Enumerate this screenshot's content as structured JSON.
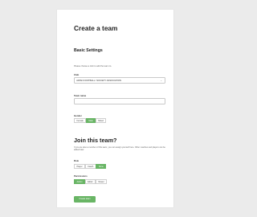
{
  "page": {
    "title": "Create a team",
    "basic_settings_title": "Basic Settings",
    "help_text": "Please choose a club to add the team to."
  },
  "club": {
    "label": "Club",
    "selected": "JAPAN FOOTBALL / SOCIETY ASSOCIATION"
  },
  "team_name": {
    "label": "Team name",
    "value": ""
  },
  "gender": {
    "label": "Gender",
    "options": [
      "Female",
      "Male",
      "Mixed"
    ],
    "selected": "Male"
  },
  "join": {
    "title": "Join this team?",
    "help_text": "If you are also a member of this team, you can assign yourself here. Other coaches and players can be added later.",
    "role": {
      "label": "Role",
      "options": [
        "Player",
        "Coach",
        "None"
      ],
      "selected": "None"
    },
    "permissions": {
      "label": "Permissions",
      "options": [
        "Admin",
        "Editor",
        "Viewer"
      ],
      "selected": "Admin"
    }
  },
  "actions": {
    "create_label": "Create team"
  },
  "colors": {
    "accent": "#69b565",
    "background": "#ebebeb",
    "card": "#ffffff"
  },
  "icons": {
    "select_chevron": "chevron-down-icon"
  }
}
